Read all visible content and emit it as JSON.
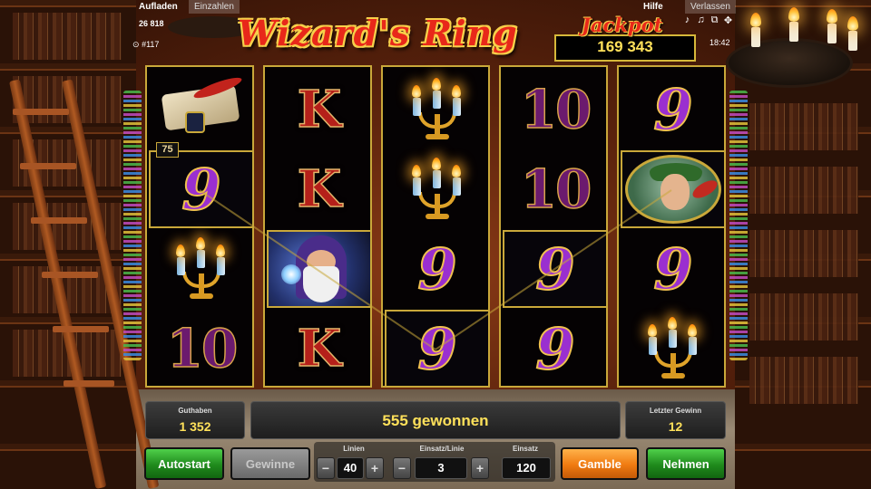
{
  "header": {
    "tab_reload": "Aufladen",
    "tab_single": "Einzahlen",
    "balance_display": "26 818",
    "session_id": "#117",
    "help": "Hilfe",
    "leave": "Verlassen",
    "clock": "18:42"
  },
  "game": {
    "title": "Wizard's Ring",
    "jackpot_label": "Jackpot",
    "jackpot_value": "169 343",
    "line_badge": "75"
  },
  "reels": [
    [
      "book",
      "9",
      "candelabra",
      "10"
    ],
    [
      "K",
      "K",
      "wizard",
      "K"
    ],
    [
      "candelabra",
      "candelabra",
      "9",
      "9"
    ],
    [
      "10",
      "10",
      "9",
      "9"
    ],
    [
      "9",
      "hero",
      "9",
      "candelabra"
    ]
  ],
  "win_cells": [
    [
      0,
      1
    ],
    [
      1,
      2
    ],
    [
      2,
      3
    ],
    [
      3,
      2
    ],
    [
      4,
      1
    ]
  ],
  "footer": {
    "balance_label": "Guthaben",
    "balance_value": "1 352",
    "win_message": "555 gewonnen",
    "last_win_label": "Letzter Gewinn",
    "last_win_value": "12",
    "autostart": "Autostart",
    "winnings": "Gewinne",
    "lines_label": "Linien",
    "lines_value": "40",
    "bet_per_line_label": "Einsatz/Linie",
    "bet_per_line_value": "3",
    "total_bet_label": "Einsatz",
    "total_bet_value": "120",
    "gamble": "Gamble",
    "take": "Nehmen",
    "minus": "−",
    "plus": "+"
  },
  "colors": {
    "accent_gold": "#c9a83a",
    "value_yellow": "#ffe15a",
    "logo_red": "#e8281a",
    "button_green": "#1f8a1c",
    "button_orange": "#f07a10"
  }
}
